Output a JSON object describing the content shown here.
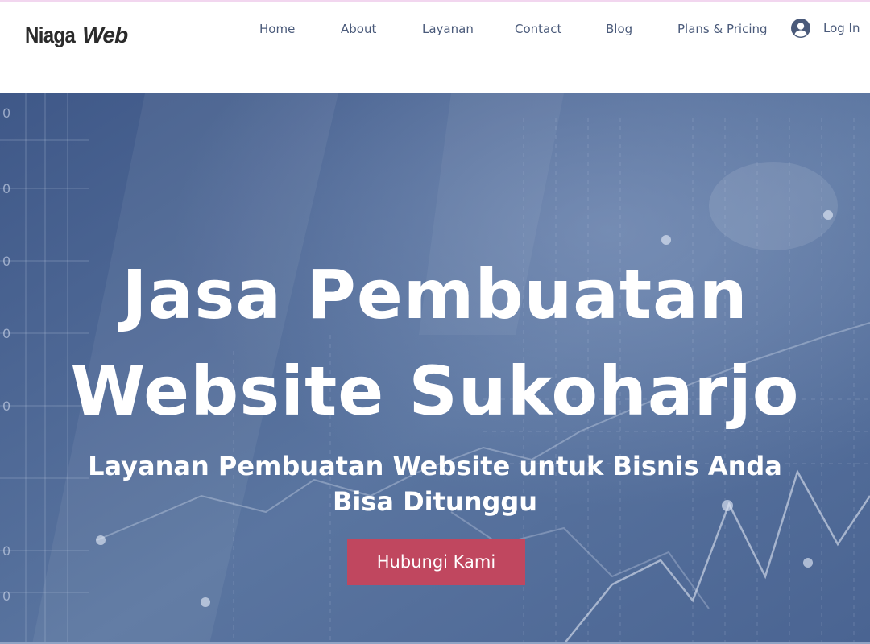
{
  "header": {
    "logo_part1": "Niaga",
    "logo_part2": "Web",
    "nav": [
      {
        "label": "Home"
      },
      {
        "label": "About"
      },
      {
        "label": "Layanan"
      },
      {
        "label": "Contact"
      },
      {
        "label": "Blog"
      },
      {
        "label": "Plans & Pricing"
      }
    ],
    "login_label": "Log In",
    "login_icon": "user-avatar-icon"
  },
  "hero": {
    "title_line1": "Jasa Pembuatan",
    "title_line2": "Website Sukoharjo",
    "subtitle_line1": "Layanan Pembuatan Website untuk Bisnis Anda",
    "subtitle_line2": "Bisa Ditunggu",
    "cta_label": "Hubungi Kami",
    "axis_labels": [
      "0",
      "0",
      "0",
      "0",
      "0",
      "0",
      "0"
    ]
  },
  "colors": {
    "nav_text": "#4a5a7a",
    "hero_overlay": "#506b97",
    "cta_bg": "#c0475f",
    "top_accent": "#f2d6ef"
  }
}
